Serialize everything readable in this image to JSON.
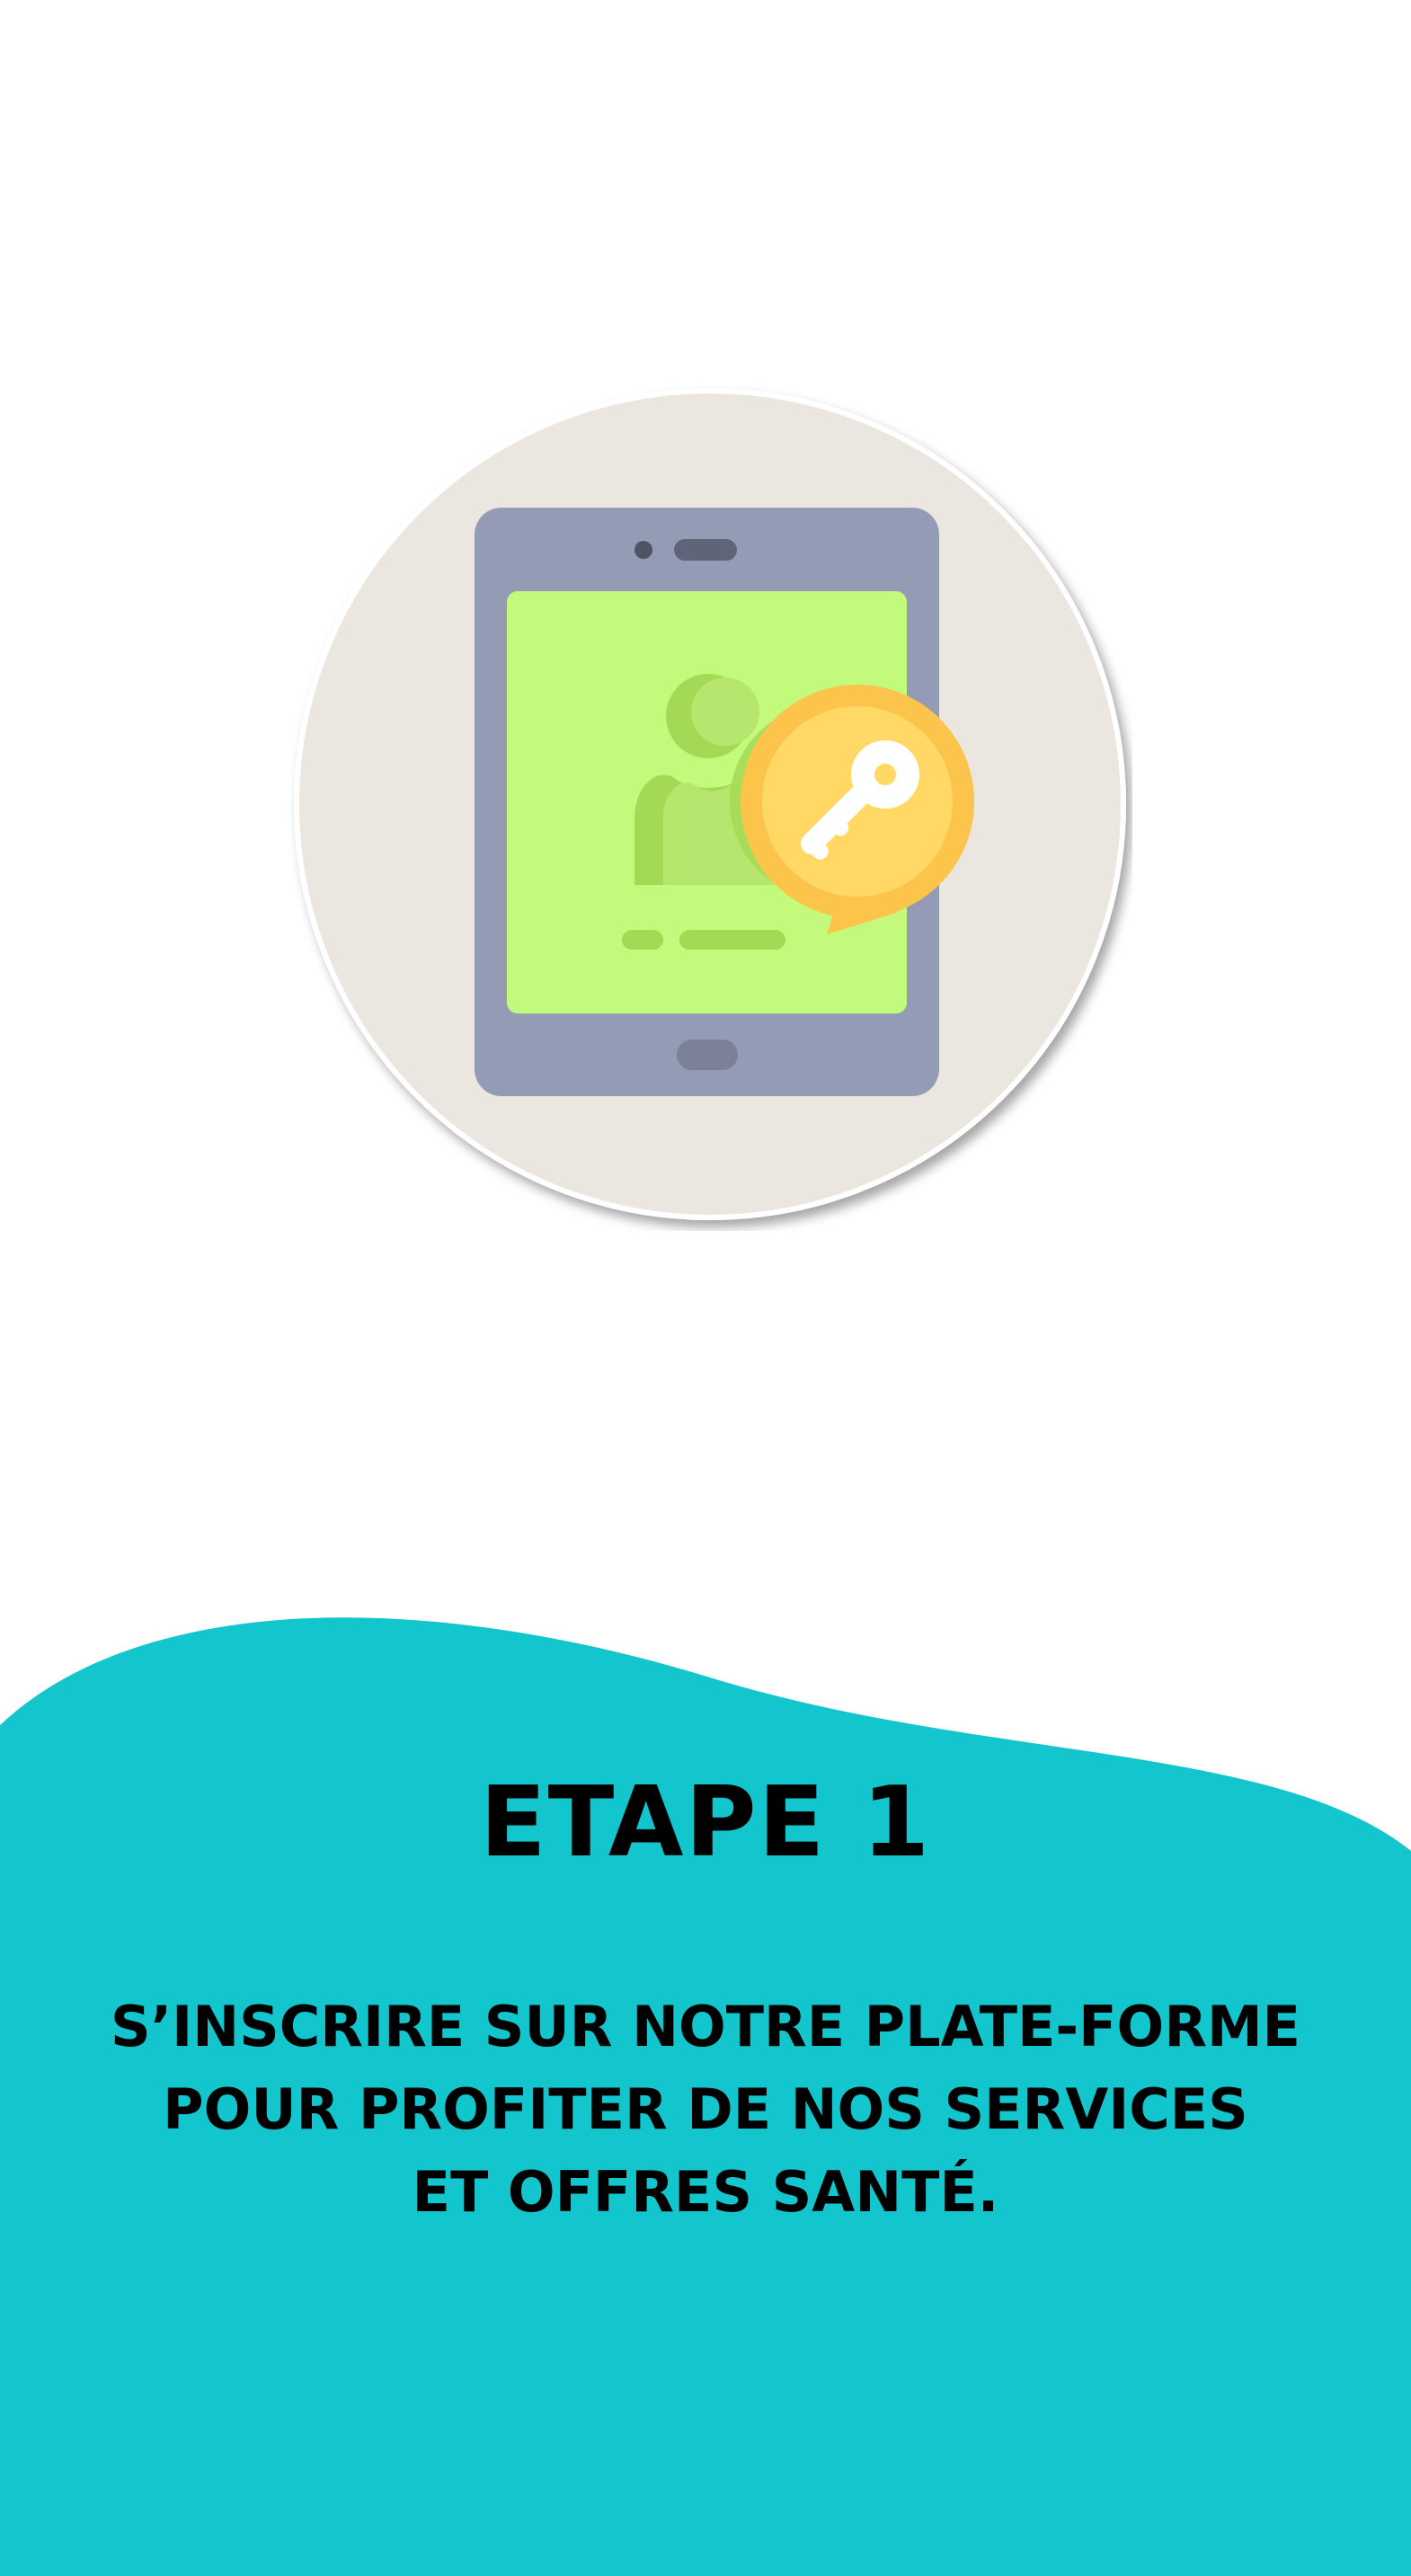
{
  "step": {
    "title": "ETAPE 1",
    "description_lines": [
      "S’INSCRIRE SUR NOTRE PLATE-FORME",
      "POUR PROFITER DE NOS SERVICES",
      "ET OFFRES SANTÉ."
    ]
  },
  "illustration": {
    "icon": "tablet-user-key-icon"
  },
  "colors": {
    "background": "#ffffff",
    "wave": "#13c6ce",
    "circle": "#ece6e0",
    "tablet": "#949bb5",
    "screen": "#c4fa7c",
    "user": "#a3d955",
    "key_badge": "#fcc44b",
    "key": "#ffffff",
    "text": "#000000"
  }
}
